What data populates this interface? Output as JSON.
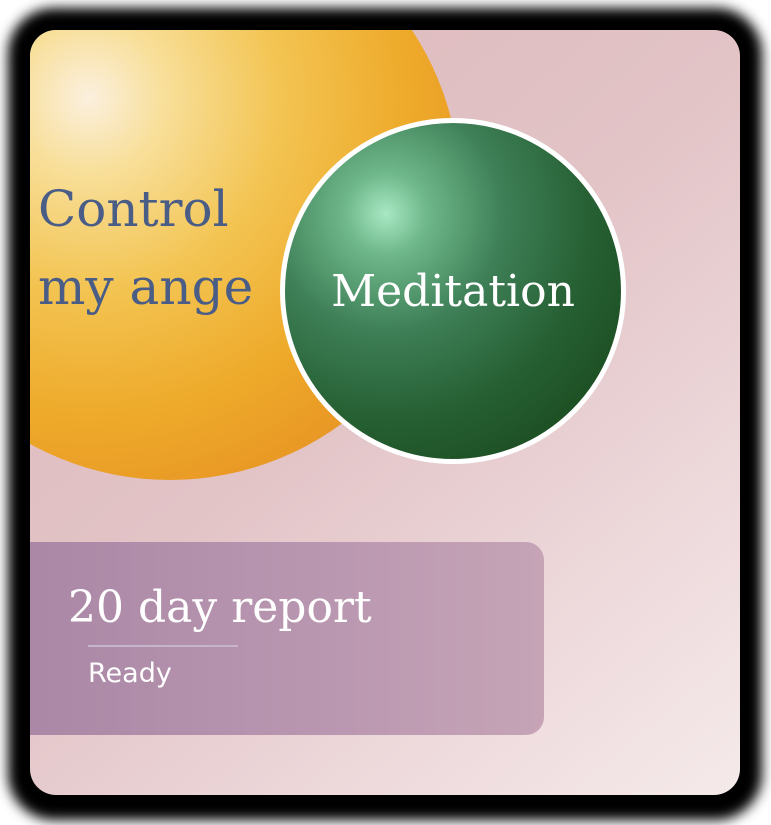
{
  "goal_bubble": {
    "line1": "Control",
    "line2": "my ange"
  },
  "activity_bubble": {
    "label": "Meditation"
  },
  "report": {
    "title": "20 day report",
    "status": "Ready"
  },
  "colors": {
    "goal_sphere": "#f0b232",
    "goal_text": "#4a5d86",
    "activity_sphere": "#1f5226",
    "report_panel": "#b08fac",
    "card_background": "#e2c3c6"
  }
}
